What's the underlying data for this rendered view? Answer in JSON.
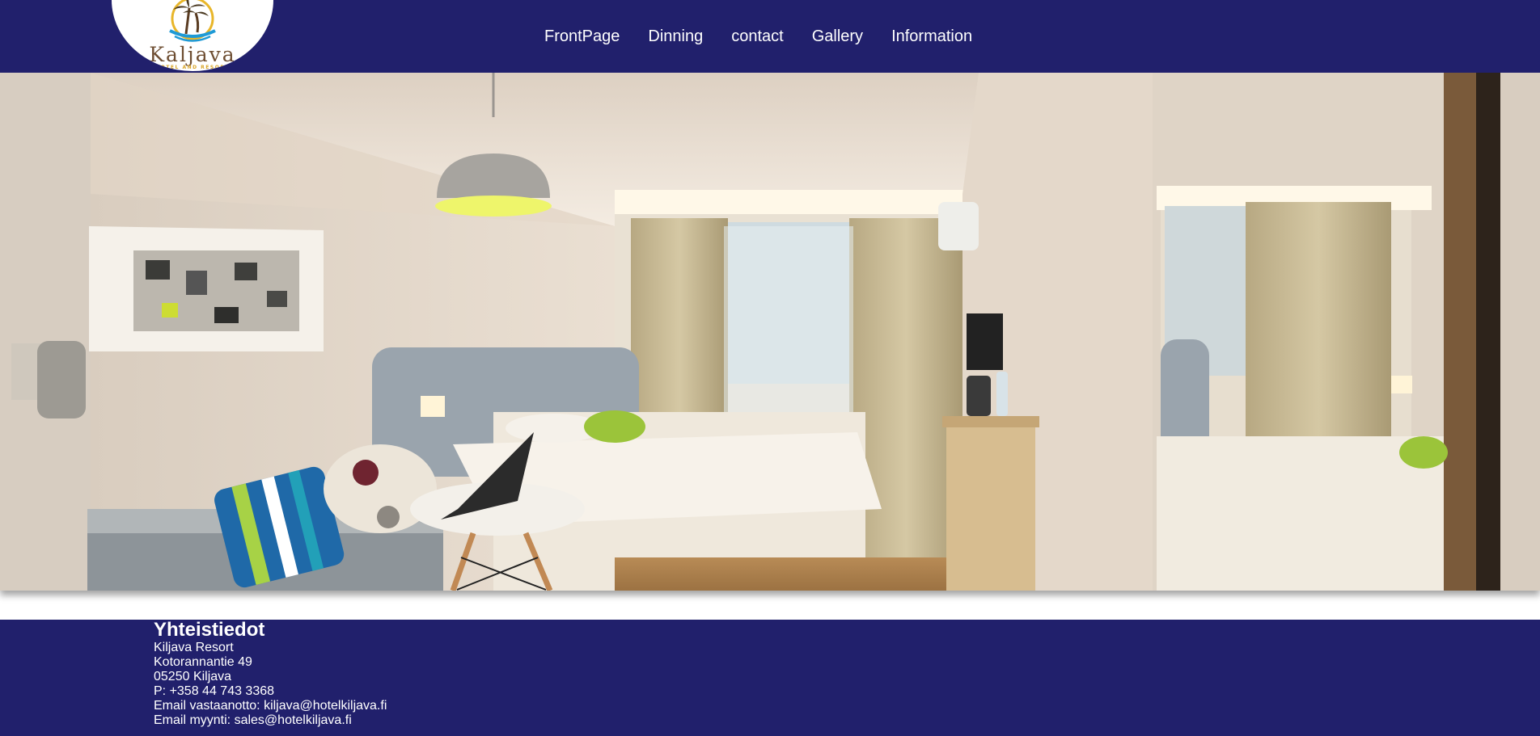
{
  "header": {
    "logo": {
      "name": "Kaljava",
      "tagline": "HOTEL AND RESORT"
    },
    "nav": [
      {
        "label": "FrontPage"
      },
      {
        "label": "Dinning"
      },
      {
        "label": "contact"
      },
      {
        "label": "Gallery"
      },
      {
        "label": "Information"
      }
    ]
  },
  "hero": {
    "image": "hotel-room-photo"
  },
  "footer": {
    "title": "Yhteistiedot",
    "lines": [
      "Kiljava Resort",
      "Kotorannantie 49",
      "05250 Kiljava",
      "P: +358 44 743 3368",
      "Email vastaanotto: kiljava@hotelkiljava.fi",
      "Email myynti: sales@hotelkiljava.fi"
    ]
  },
  "colors": {
    "brand_navy": "#21206c",
    "logo_brown": "#6e4e32",
    "logo_gold": "#d9a52a",
    "logo_blue": "#1e9ad6"
  }
}
